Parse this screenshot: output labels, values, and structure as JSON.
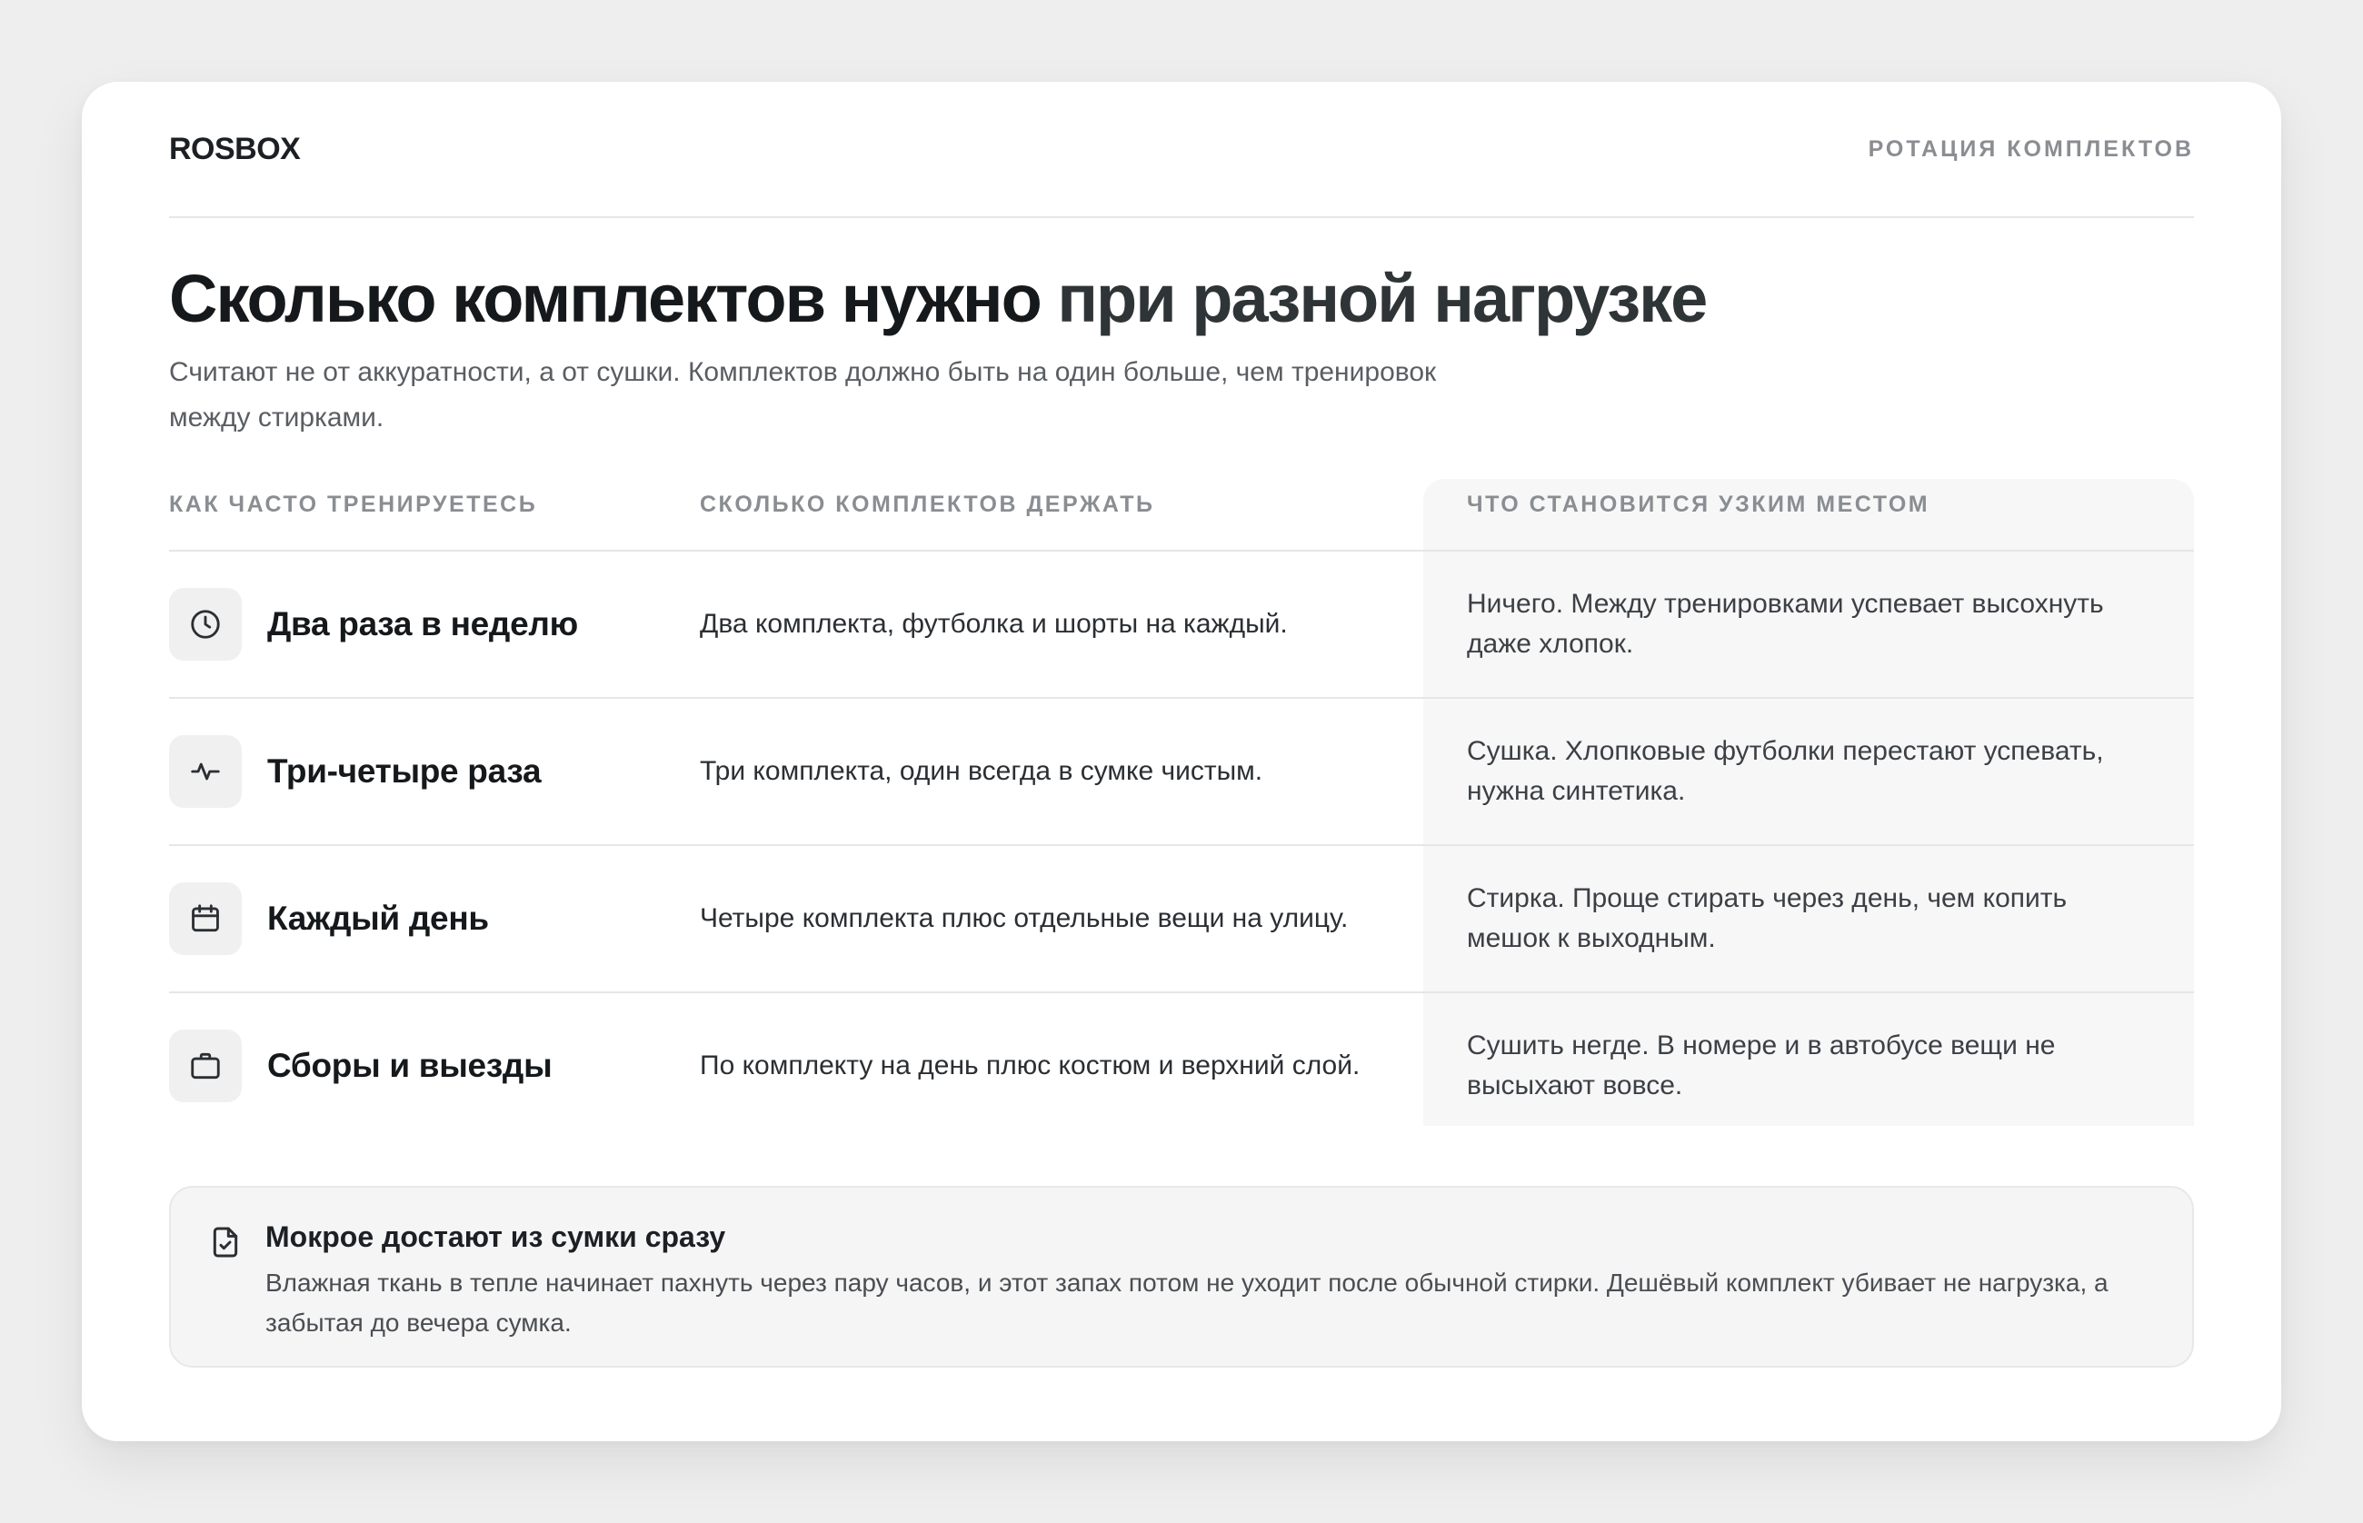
{
  "brand": {
    "logo": "ROSBOX",
    "section": "РОТАЦИЯ КОМПЛЕКТОВ"
  },
  "hero": {
    "title_strong": "Сколько комплектов нужно",
    "title_rest": "при разной нагрузке",
    "subtitle": "Считают не от аккуратности, а от сушки. Комплектов должно быть на один больше, чем тренировок между стирками."
  },
  "table": {
    "headers": [
      "КАК ЧАСТО ТРЕНИРУЕТЕСЬ",
      "СКОЛЬКО КОМПЛЕКТОВ ДЕРЖАТЬ",
      "ЧТО СТАНОВИТСЯ УЗКИМ МЕСТОМ"
    ],
    "rows": [
      {
        "icon": "clock-icon",
        "frequency": "Два раза в неделю",
        "sets": "Два комплекта, футболка и шорты на каждый.",
        "bottleneck": "Ничего. Между тренировками успевает высохнуть даже хлопок."
      },
      {
        "icon": "activity-icon",
        "frequency": "Три-четыре раза",
        "sets": "Три комплекта, один всегда в сумке чистым.",
        "bottleneck": "Сушка. Хлопковые футболки перестают успевать, нужна синтетика."
      },
      {
        "icon": "calendar-icon",
        "frequency": "Каждый день",
        "sets": "Четыре комплекта плюс отдельные вещи на улицу.",
        "bottleneck": "Стирка. Проще стирать через день, чем копить мешок к выходным."
      },
      {
        "icon": "briefcase-icon",
        "frequency": "Сборы и выезды",
        "sets": "По комплекту на день плюс костюм и верхний слой.",
        "bottleneck": "Сушить негде. В номере и в автобусе вещи не высыхают вовсе."
      }
    ]
  },
  "note": {
    "icon": "document-check-icon",
    "title": "Мокрое достают из сумки сразу",
    "text": "Влажная ткань в тепле начинает пахнуть через пару часов, и этот запах потом не уходит после обычной стирки. Дешёвый комплект убивает не нагрузка, а забытая до вечера сумка."
  },
  "colors": {
    "background": "#eeeeef",
    "card": "#ffffff",
    "text": "#1c2024",
    "muted": "#8a8d91",
    "highlight_column": "#f7f7f7"
  }
}
